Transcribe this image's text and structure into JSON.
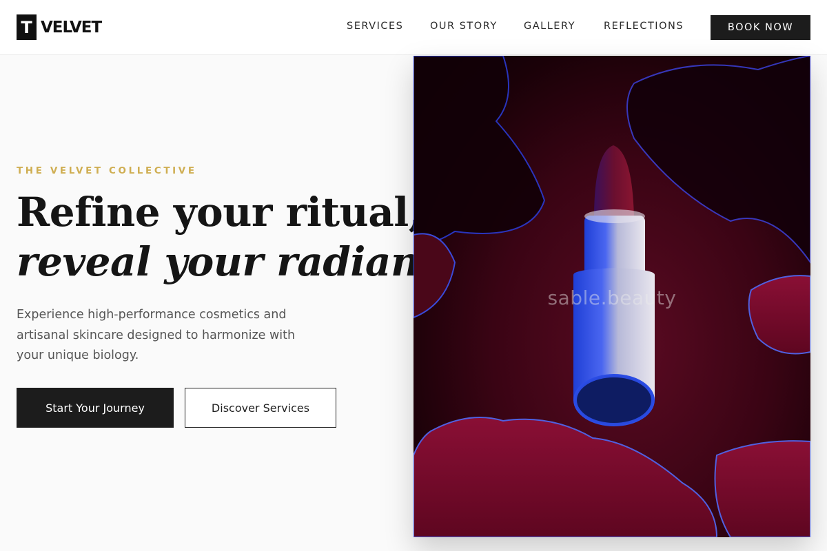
{
  "brand": {
    "mark": "T",
    "name": "VELVET"
  },
  "nav": {
    "items": [
      {
        "label": "SERVICES"
      },
      {
        "label": "OUR STORY"
      },
      {
        "label": "GALLERY"
      },
      {
        "label": "REFLECTIONS"
      }
    ],
    "cta_label": "BOOK NOW"
  },
  "hero": {
    "eyebrow": "THE VELVET COLLECTIVE",
    "headline_line1": "Refine your ritual,",
    "headline_line2": "reveal your radiance.",
    "description": "Experience high-performance cosmetics and artisanal skincare designed to harmonize with your unique biology.",
    "primary_cta": "Start Your Journey",
    "secondary_cta": "Discover Services",
    "image_watermark": "sable.beauty"
  },
  "colors": {
    "accent_gold": "#cfae52",
    "button_dark": "#1c1c1c",
    "background": "#fafafa",
    "image_red": "#5a0a22"
  }
}
